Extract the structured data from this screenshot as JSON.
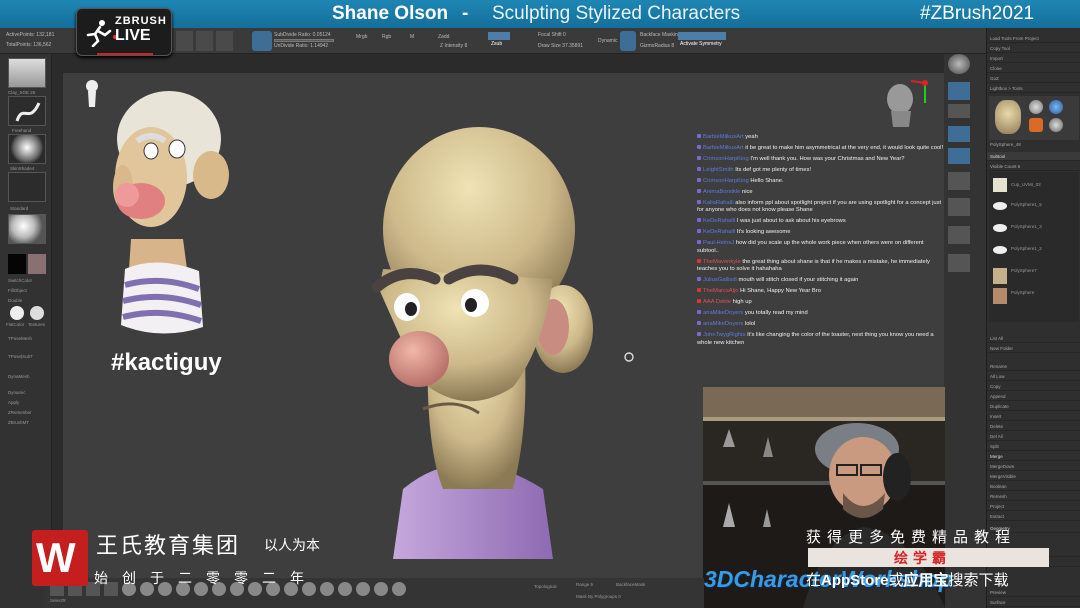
{
  "banner": {
    "name": "Shane Olson",
    "dash": "-",
    "course": "Sculpting Stylized Characters",
    "hashtag": "#ZBrush2021"
  },
  "logo": {
    "top": "ZBRUSH",
    "bottom": "LIVE"
  },
  "stats": {
    "active_points": "ActivePoints: 132,181",
    "total_points": "TotalPoints: 136,562"
  },
  "toolbar": {
    "subdivide": "SubDivide Ratio: 0.05124",
    "undivide": "UnDivide Ratio: 1.14942",
    "mrgb": "Mrgb",
    "rgb": "Rgb",
    "m": "M",
    "zadd": "Zadd",
    "zsub": "Zsub",
    "z_intensity": "Z Intensity 8",
    "focal_shift": "Focal Shift 0",
    "draw_size": "Draw Size 37.35891",
    "dynamic": "Dynamic",
    "backface": "Backface Masking",
    "activate_symmetry": "Activate Symmetry",
    "gizmo_radius": "GizmoRadius 8"
  },
  "left_shelf": {
    "items": [
      "Clay_SOE 26",
      "Freehand",
      "SkinShade4",
      "Standard",
      "SwitchColor",
      "FillObject",
      "Double",
      "FlatColor",
      "Textures",
      "TPoseMesh",
      "TPose|SubT",
      "DynaMesh",
      "Dynamic",
      "Apply",
      "ZRemesher",
      "ZBrushMT"
    ]
  },
  "viewport": {
    "tag": "#kactiguy"
  },
  "chat": [
    {
      "user": "BarbieMilkusArt",
      "text": "yeah",
      "red": false
    },
    {
      "user": "BarbieMilkusArt",
      "text": "it be great to make him asymmetrical at the very end, it would look quite cool!",
      "red": false
    },
    {
      "user": "CrimsonHarpKing",
      "text": "I'm well thank you. How was your Christmas and New Year?",
      "red": false
    },
    {
      "user": "LeightSmith",
      "text": "Its def got me plenty of times!",
      "red": false
    },
    {
      "user": "CrimsonHarpKing",
      "text": "Hello Shane.",
      "red": false
    },
    {
      "user": "AnimaBorstkle",
      "text": "nice",
      "red": false
    },
    {
      "user": "KaliaRahalli",
      "text": "also inform ppl about spotlight project if you are using spotlight for a concept just for anyone who does not know please Shane",
      "red": false
    },
    {
      "user": "KeDeRahalli",
      "text": "I was just about to ask about his eyebrows",
      "red": false
    },
    {
      "user": "KeDeRahalli",
      "text": "It's looking awesome",
      "red": false
    },
    {
      "user": "Paul-HeinsJ",
      "text": "how did you scale up the whole work piece when others were on different subtool..",
      "red": false
    },
    {
      "user": "TheMavenkyle",
      "text": "the great thing about shane is that if he makes a mistake, he immediately teaches you to solve it hahahaha",
      "red": true
    },
    {
      "user": "JuliusGallisdi",
      "text": "mouth will stitch closed if your stitching it again",
      "red": false
    },
    {
      "user": "TheMarcsAljo",
      "text": "Hi Shane, Happy New Year Bro",
      "red": true
    },
    {
      "user": "AAA Dekte",
      "text": "high up",
      "red": true
    },
    {
      "user": "ariaMikeDoyers",
      "text": "you totally read my mind",
      "red": false
    },
    {
      "user": "ariaMikeDoyers",
      "text": "lolol",
      "red": false
    },
    {
      "user": "JohnTwygRights",
      "text": "It's like changing the color of the toaster, next thing you know you need a whole new kitchen",
      "red": false
    }
  ],
  "tray": {
    "top_buttons": [
      "Load Tools From Project",
      "Copy Tool",
      "Paste Tool",
      "Import",
      "Export",
      "Clone",
      "Make PolyMesh3D",
      "GoZ",
      "All",
      "Visible",
      "R",
      "Lightbox > Tools"
    ],
    "tool_label": "PolySphere_48",
    "subtool_header": "Subtool",
    "visible_count": "Visible Count 6",
    "subtools": [
      "Cup_UVMr_02",
      "PolySphere1_5",
      "PolySphere1_3",
      "PolySphere1_2",
      "PolySphere7",
      "PolySphere"
    ],
    "lower_buttons": [
      "List All",
      "New Folder",
      "Rename",
      "AutoReorder",
      "All Low",
      "All High",
      "Copy",
      "Paste",
      "Append",
      "Duplicate",
      "Insert",
      "Delete",
      "Del Other",
      "Del All",
      "Split",
      "Merge",
      "MergeDown",
      "MergeSimilar",
      "MergeVisible",
      "Weld",
      "Uv",
      "Boolean",
      "Remesh",
      "Project",
      "Extract",
      "Geometry",
      "ArrayMesh",
      "NanoMesh",
      "Layers",
      "FiberMesh",
      "Preview",
      "Surface"
    ]
  },
  "bottom_shelf": {
    "labels": [
      "SelectR",
      "SelectLa",
      "MaskPe",
      "MaskLas",
      "Move",
      "Move Ex",
      "SnakeH",
      "Inflate",
      "Pinch",
      "hPolish",
      "ZModel",
      "Curve",
      "ClayBuil",
      "Standard",
      "TrimDyn",
      "ClipCurv",
      "TrimCur",
      "Topolog",
      "IMM",
      "ZCylinder",
      "ZModeler",
      "IMM",
      "hPolish"
    ],
    "range": "Range 5",
    "backface_mask": "BackfaceMask",
    "mask_by_polygroups": "Mask By Polygroups 0",
    "topological": "Topological"
  },
  "watermark": {
    "company": "王氏教育集团",
    "slogan": "以人为本",
    "sub": "始创于二零零二年",
    "promo_line1": "获得更多免费精品教程",
    "promo_line2": "绘学霸",
    "promo_line3_a": "在",
    "promo_line3_b": "AppStore",
    "promo_line3_c": "或",
    "promo_line3_d": "应用宝",
    "promo_line3_e": "搜索下载",
    "cw_logo": "3DCharacterWorkshop"
  },
  "colors": {
    "banner": "#1a7aab",
    "viewport": "#3e3e3e",
    "accent_red": "#c41e1e",
    "promo_red": "#d7262c"
  }
}
